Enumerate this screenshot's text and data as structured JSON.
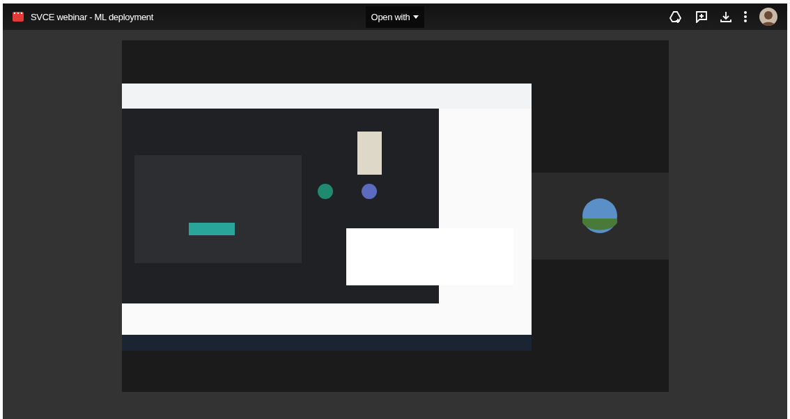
{
  "file": {
    "title": "SVCE webinar - ML deployment"
  },
  "open_with": {
    "label": "Open with"
  }
}
